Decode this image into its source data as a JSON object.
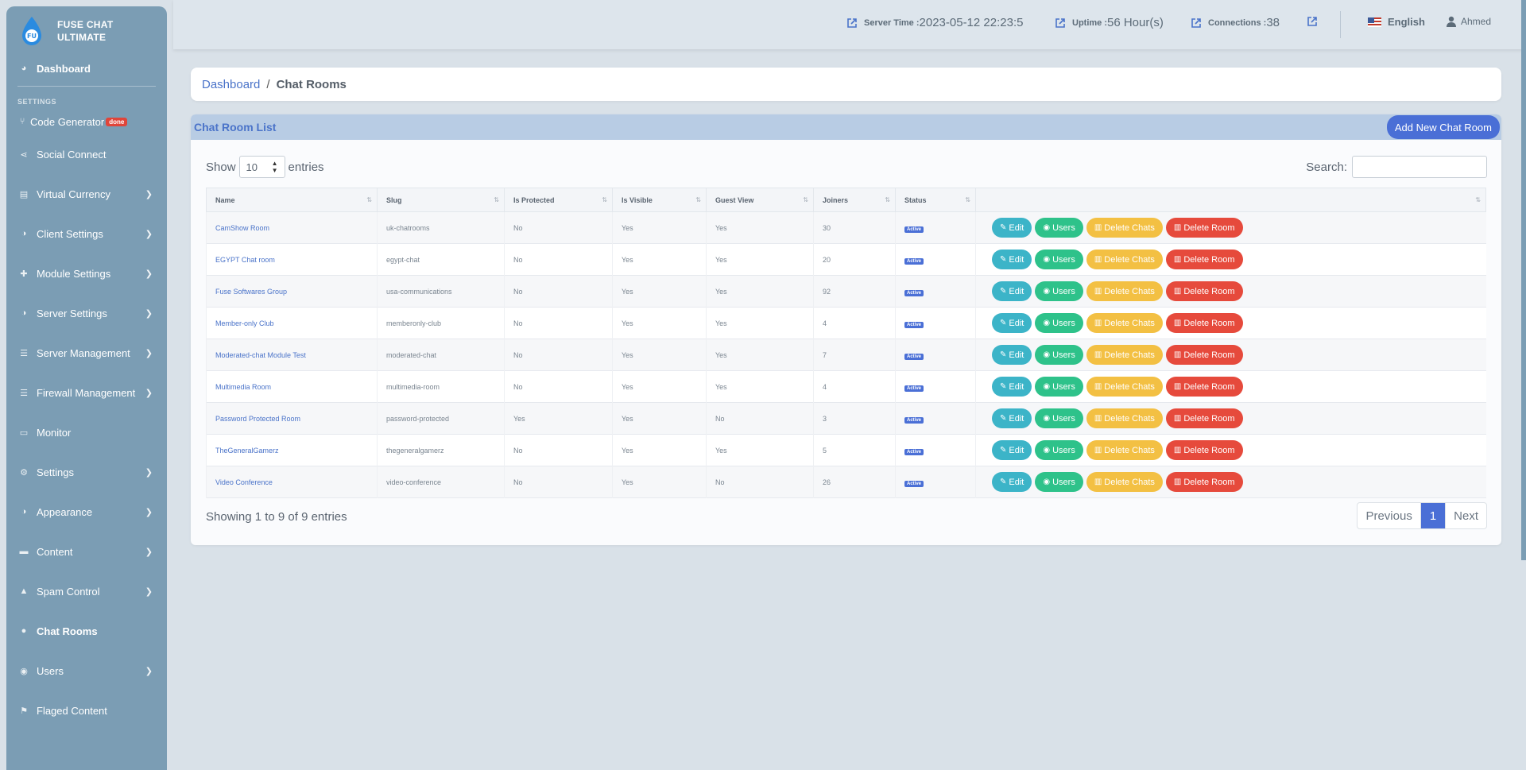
{
  "brand": {
    "line1": "FUSE CHAT",
    "line2": "ULTIMATE"
  },
  "sidebar": {
    "dashboard": "Dashboard",
    "section_settings": "SETTINGS",
    "code_generator": "Code Generator",
    "code_generator_badge": "done",
    "items": [
      {
        "label": "Social Connect",
        "icon": "share-icon",
        "chevron": false
      },
      {
        "label": "Virtual Currency",
        "icon": "coins-icon",
        "chevron": true
      },
      {
        "label": "Client Settings",
        "icon": "palette-icon",
        "chevron": true
      },
      {
        "label": "Module Settings",
        "icon": "puzzle-icon",
        "chevron": true
      },
      {
        "label": "Server Settings",
        "icon": "palette-icon",
        "chevron": true
      },
      {
        "label": "Server Management",
        "icon": "list-icon",
        "chevron": true
      },
      {
        "label": "Firewall Management",
        "icon": "list-icon",
        "chevron": true
      },
      {
        "label": "Monitor",
        "icon": "monitor-icon",
        "chevron": false
      },
      {
        "label": "Settings",
        "icon": "gear-icon",
        "chevron": true
      },
      {
        "label": "Appearance",
        "icon": "palette-icon",
        "chevron": true
      },
      {
        "label": "Content",
        "icon": "content-icon",
        "chevron": true
      },
      {
        "label": "Spam Control",
        "icon": "shield-icon",
        "chevron": true
      },
      {
        "label": "Chat Rooms",
        "icon": "comments-icon",
        "chevron": false,
        "active": true
      },
      {
        "label": "Users",
        "icon": "users-icon",
        "chevron": true
      },
      {
        "label": "Flaged Content",
        "icon": "flag-icon",
        "chevron": false
      }
    ]
  },
  "topbar": {
    "server_time_label": "Server Time :",
    "server_time_value": "2023-05-12 22:23:5",
    "uptime_label": "Uptime :",
    "uptime_value": "56 Hour(s)",
    "connections_label": "Connections :",
    "connections_value": "38",
    "language": "English",
    "user": "Ahmed"
  },
  "breadcrumb": {
    "home": "Dashboard",
    "separator": "/",
    "current": "Chat Rooms"
  },
  "card": {
    "title": "Chat Room List",
    "add_button": "Add New Chat Room",
    "show_label": "Show",
    "entries_label": "entries",
    "page_size": "10",
    "search_label": "Search:"
  },
  "table": {
    "columns": [
      "Name",
      "Slug",
      "Is Protected",
      "Is Visible",
      "Guest View",
      "Joiners",
      "Status",
      ""
    ],
    "status_text": "Active",
    "actions": {
      "edit": "Edit",
      "users": "Users",
      "delete_chats": "Delete Chats",
      "delete_room": "Delete Room"
    },
    "rows": [
      {
        "name": "CamShow Room",
        "slug": "uk-chatrooms",
        "protected": "No",
        "visible": "Yes",
        "guest": "Yes",
        "joiners": "30"
      },
      {
        "name": "EGYPT Chat room",
        "slug": "egypt-chat",
        "protected": "No",
        "visible": "Yes",
        "guest": "Yes",
        "joiners": "20"
      },
      {
        "name": "Fuse Softwares Group",
        "slug": "usa-communications",
        "protected": "No",
        "visible": "Yes",
        "guest": "Yes",
        "joiners": "92"
      },
      {
        "name": "Member-only Club",
        "slug": "memberonly-club",
        "protected": "No",
        "visible": "Yes",
        "guest": "Yes",
        "joiners": "4"
      },
      {
        "name": "Moderated-chat Module Test",
        "slug": "moderated-chat",
        "protected": "No",
        "visible": "Yes",
        "guest": "Yes",
        "joiners": "7"
      },
      {
        "name": "Multimedia Room",
        "slug": "multimedia-room",
        "protected": "No",
        "visible": "Yes",
        "guest": "Yes",
        "joiners": "4"
      },
      {
        "name": "Password Protected Room",
        "slug": "password-protected",
        "protected": "Yes",
        "visible": "Yes",
        "guest": "No",
        "joiners": "3"
      },
      {
        "name": "TheGeneralGamerz",
        "slug": "thegeneralgamerz",
        "protected": "No",
        "visible": "Yes",
        "guest": "Yes",
        "joiners": "5"
      },
      {
        "name": "Video Conference",
        "slug": "video-conference",
        "protected": "No",
        "visible": "Yes",
        "guest": "No",
        "joiners": "26"
      }
    ]
  },
  "footer": {
    "info": "Showing 1 to 9 of 9 entries",
    "previous": "Previous",
    "page": "1",
    "next": "Next"
  },
  "colors": {
    "sidebar": "#7b9db4",
    "accent": "#4a6fd6",
    "edit": "#3cb4c8",
    "users": "#2ec28a",
    "delete_chats": "#f3c043",
    "delete_room": "#e64a3c"
  }
}
